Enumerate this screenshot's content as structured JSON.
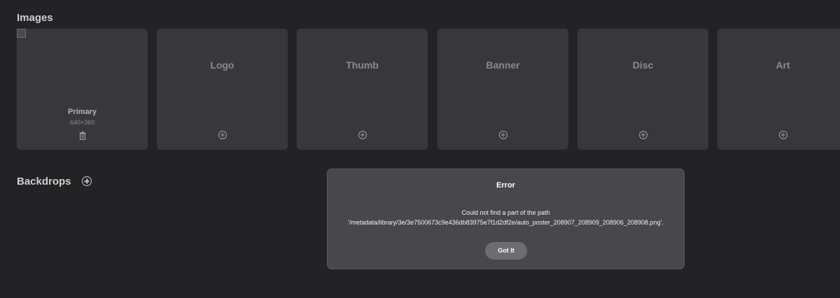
{
  "images_section": {
    "title": "Images",
    "primary": {
      "name": "Primary",
      "dimensions": "640×360"
    },
    "cards": [
      {
        "label": "Logo"
      },
      {
        "label": "Thumb"
      },
      {
        "label": "Banner"
      },
      {
        "label": "Disc"
      },
      {
        "label": "Art"
      }
    ]
  },
  "backdrops_section": {
    "title": "Backdrops"
  },
  "error_dialog": {
    "title": "Error",
    "message_line1": "Could not find a part of the path",
    "message_line2": "'/metadata/library/3e/3e7500673c9e436db83975e7f1d2df2e/auto_poster_208907_208909_208906_208908.png'.",
    "button_label": "Got It"
  },
  "icons": {
    "add": "plus-circle-icon",
    "delete": "trash-icon",
    "broken_image": "broken-image-icon"
  }
}
